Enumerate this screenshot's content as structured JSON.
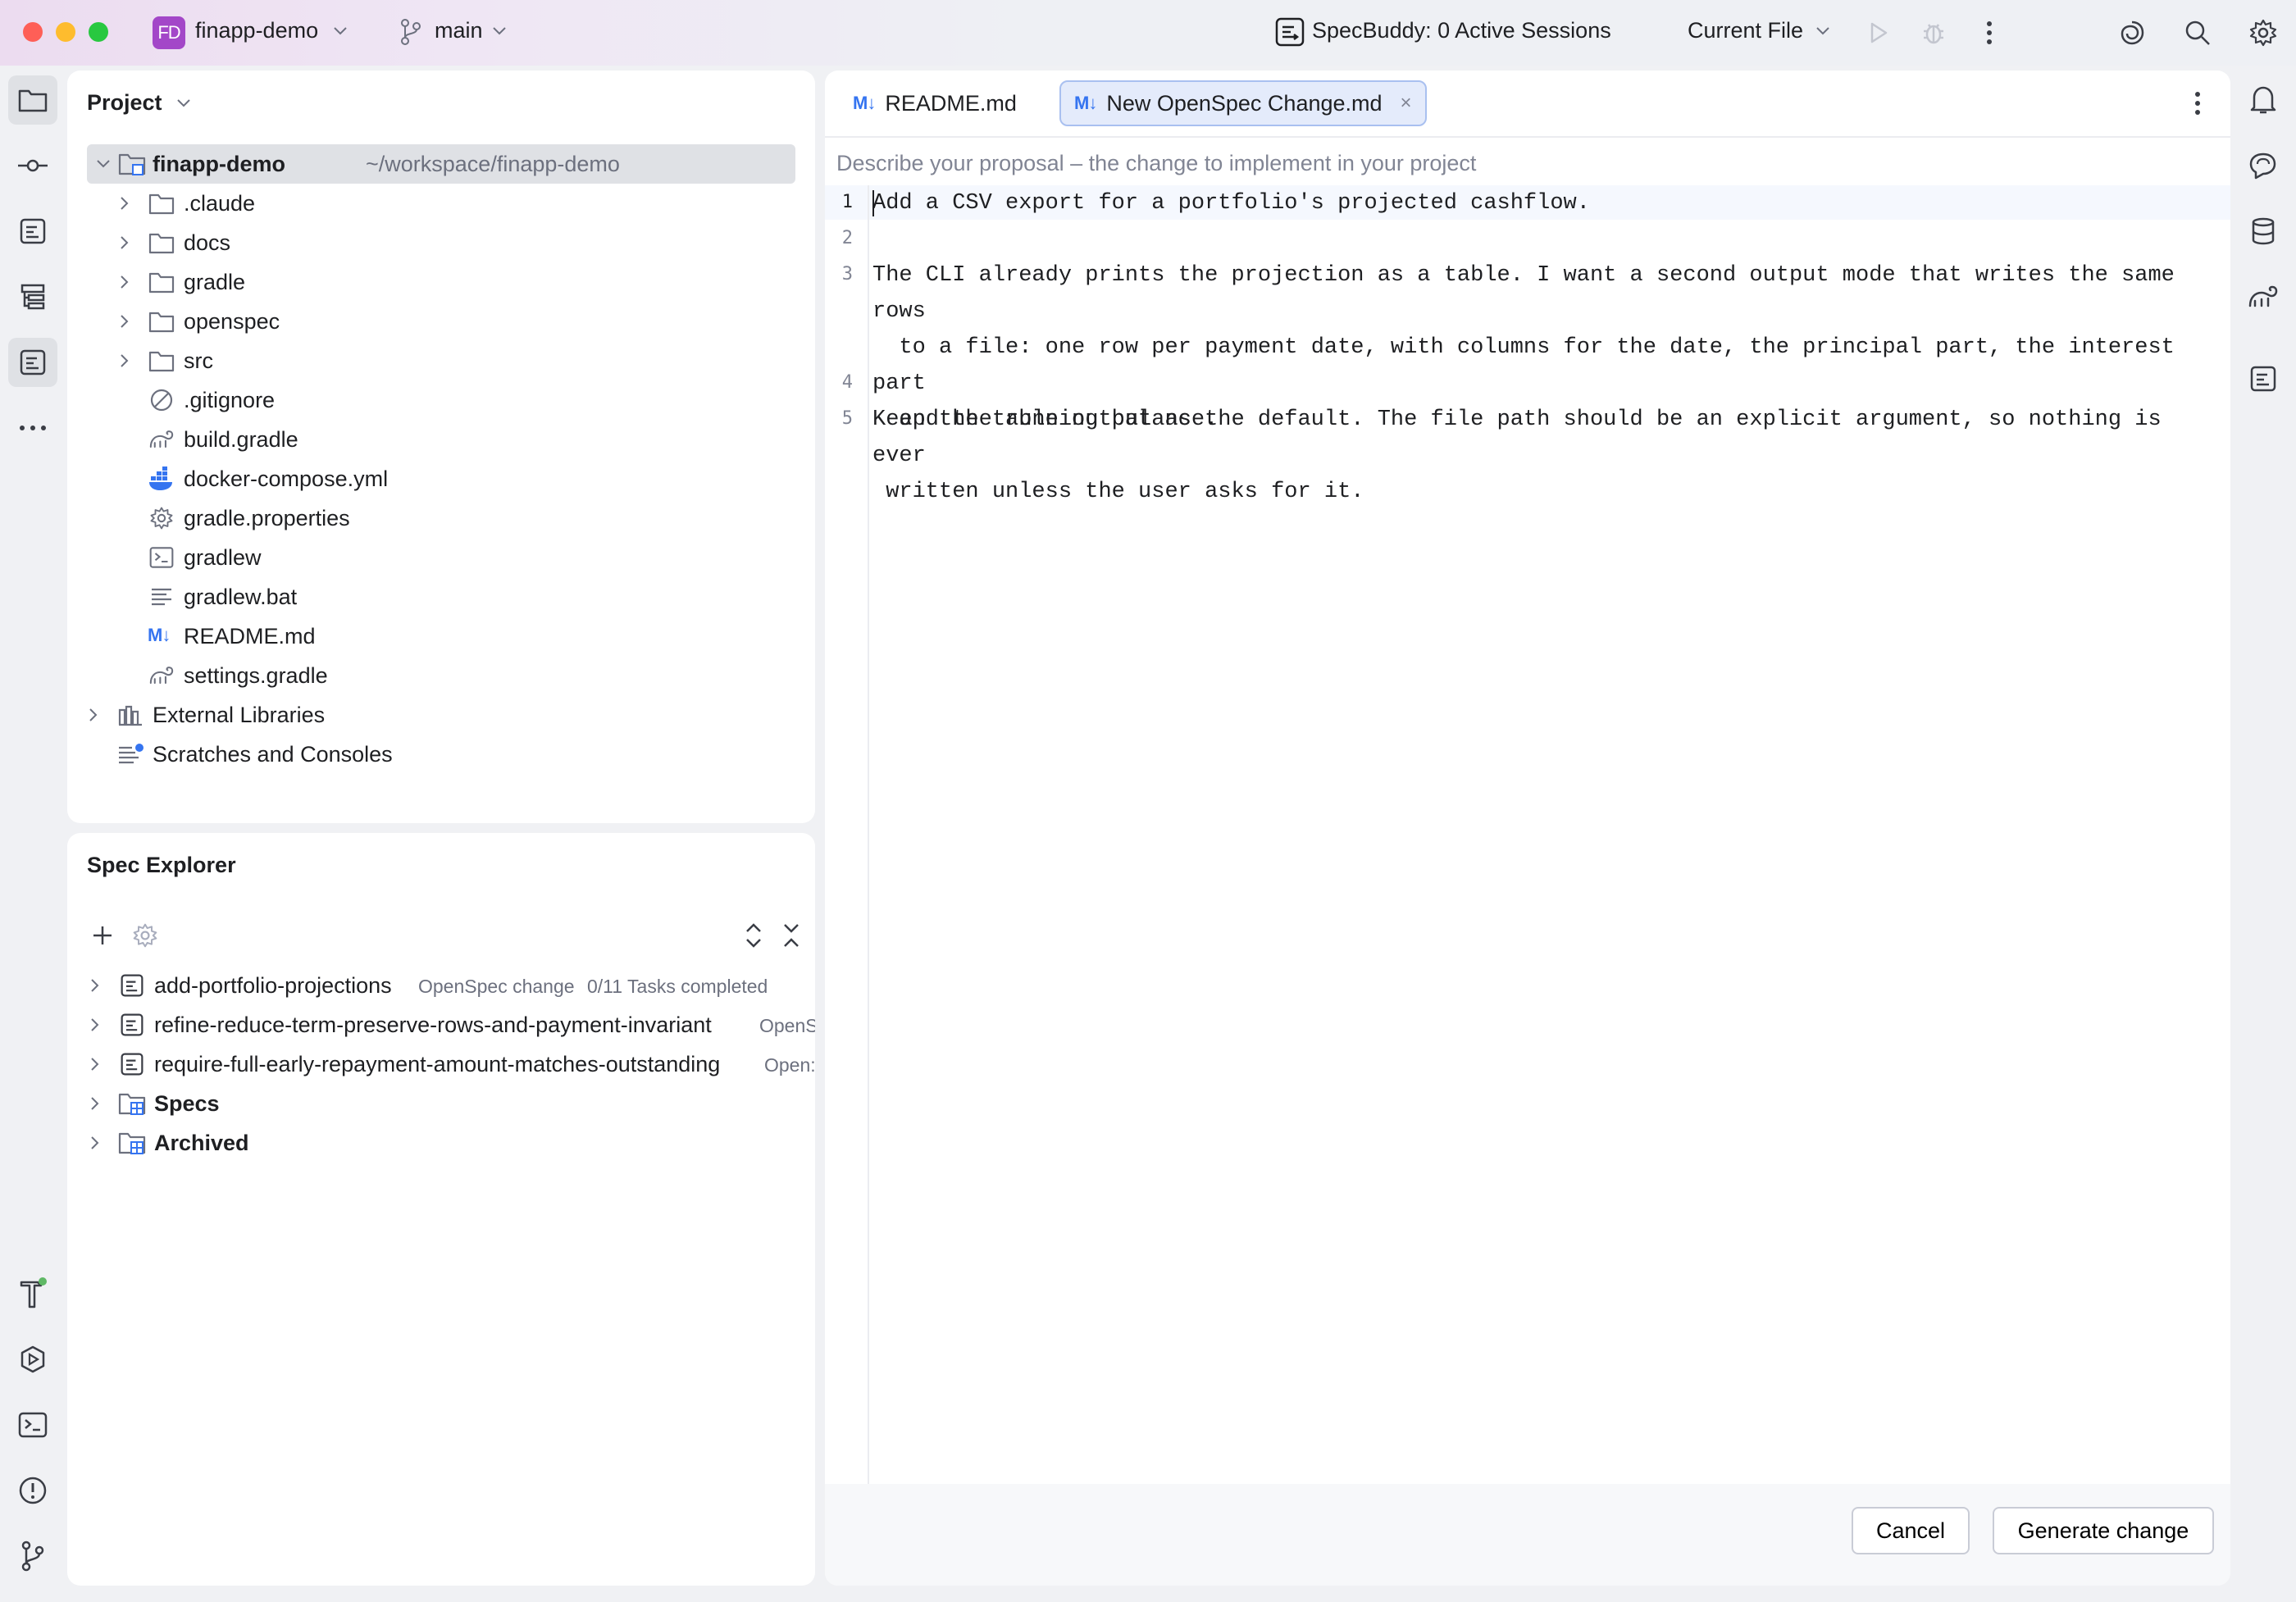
{
  "titlebar": {
    "project_badge": "FD",
    "project_name": "finapp-demo",
    "branch": "main",
    "specbuddy_status": "SpecBuddy: 0 Active Sessions",
    "run_config": "Current File"
  },
  "project_panel": {
    "title": "Project",
    "root": {
      "name": "finapp-demo",
      "path": "~/workspace/finapp-demo"
    },
    "folders": [
      ".claude",
      "docs",
      "gradle",
      "openspec",
      "src"
    ],
    "files": [
      {
        "name": ".gitignore",
        "icon": "ignore-icon"
      },
      {
        "name": "build.gradle",
        "icon": "gradle-icon"
      },
      {
        "name": "docker-compose.yml",
        "icon": "docker-icon"
      },
      {
        "name": "gradle.properties",
        "icon": "settings-icon"
      },
      {
        "name": "gradlew",
        "icon": "shell-icon"
      },
      {
        "name": "gradlew.bat",
        "icon": "text-icon"
      },
      {
        "name": "README.md",
        "icon": "markdown-icon"
      },
      {
        "name": "settings.gradle",
        "icon": "gradle-icon"
      }
    ],
    "external_libraries": "External Libraries",
    "scratches": "Scratches and Consoles"
  },
  "spec_explorer": {
    "title": "Spec Explorer",
    "changes": [
      {
        "name": "add-portfolio-projections",
        "type": "OpenSpec change",
        "tasks": "0/11 Tasks completed"
      },
      {
        "name": "refine-reduce-term-preserve-rows-and-payment-invariant",
        "type": "OpenS"
      },
      {
        "name": "require-full-early-repayment-amount-matches-outstanding",
        "type": "Open:"
      }
    ],
    "groups": [
      "Specs",
      "Archived"
    ]
  },
  "editor": {
    "tabs": [
      {
        "label": "README.md",
        "icon": "M↓"
      },
      {
        "label": "New OpenSpec Change.md",
        "icon": "M↓"
      }
    ],
    "hint": "Describe your proposal – the change to implement in your project",
    "lines": [
      {
        "n": "1",
        "text": "Add a CSV export for a portfolio's projected cashflow."
      },
      {
        "n": "2",
        "text": ""
      },
      {
        "n": "3",
        "text": "The CLI already prints the projection as a table. I want a second output mode that writes the same rows\n  to a file: one row per payment date, with columns for the date, the principal part, the interest part\n  and the running balance."
      },
      {
        "n": "4",
        "text": ""
      },
      {
        "n": "5",
        "text": "Keep the table output as the default. The file path should be an explicit argument, so nothing is ever\n written unless the user asks for it."
      }
    ],
    "cancel_label": "Cancel",
    "generate_label": "Generate change"
  },
  "colors": {
    "accent": "#3574f0",
    "selection": "#dfe1e5",
    "badge": "#a347c8"
  }
}
